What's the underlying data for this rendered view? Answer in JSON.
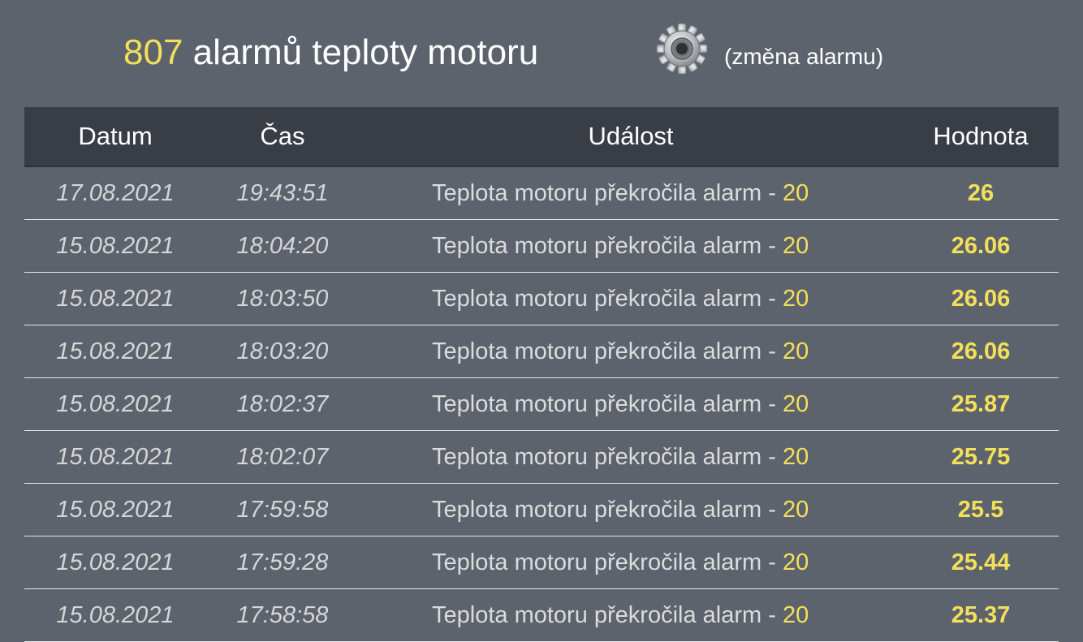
{
  "header": {
    "count": "807",
    "title": " alarmů teploty motoru",
    "change_label": "(změna alarmu)",
    "gear_icon": "gear-icon"
  },
  "table": {
    "columns": [
      "Datum",
      "Čas",
      "Událost",
      "Hodnota"
    ],
    "rows": [
      {
        "date": "17.08.2021",
        "time": "19:43:51",
        "event": "Teplota motoru překročila alarm - ",
        "limit": "20",
        "value": "26"
      },
      {
        "date": "15.08.2021",
        "time": "18:04:20",
        "event": "Teplota motoru překročila alarm - ",
        "limit": "20",
        "value": "26.06"
      },
      {
        "date": "15.08.2021",
        "time": "18:03:50",
        "event": "Teplota motoru překročila alarm - ",
        "limit": "20",
        "value": "26.06"
      },
      {
        "date": "15.08.2021",
        "time": "18:03:20",
        "event": "Teplota motoru překročila alarm - ",
        "limit": "20",
        "value": "26.06"
      },
      {
        "date": "15.08.2021",
        "time": "18:02:37",
        "event": "Teplota motoru překročila alarm - ",
        "limit": "20",
        "value": "25.87"
      },
      {
        "date": "15.08.2021",
        "time": "18:02:07",
        "event": "Teplota motoru překročila alarm - ",
        "limit": "20",
        "value": "25.75"
      },
      {
        "date": "15.08.2021",
        "time": "17:59:58",
        "event": "Teplota motoru překročila alarm - ",
        "limit": "20",
        "value": "25.5"
      },
      {
        "date": "15.08.2021",
        "time": "17:59:28",
        "event": "Teplota motoru překročila alarm - ",
        "limit": "20",
        "value": "25.44"
      },
      {
        "date": "15.08.2021",
        "time": "17:58:58",
        "event": "Teplota motoru překročila alarm - ",
        "limit": "20",
        "value": "25.37"
      }
    ]
  },
  "colors": {
    "background": "#5d636d",
    "header_bg": "#393d45",
    "accent": "#f3e05a"
  }
}
